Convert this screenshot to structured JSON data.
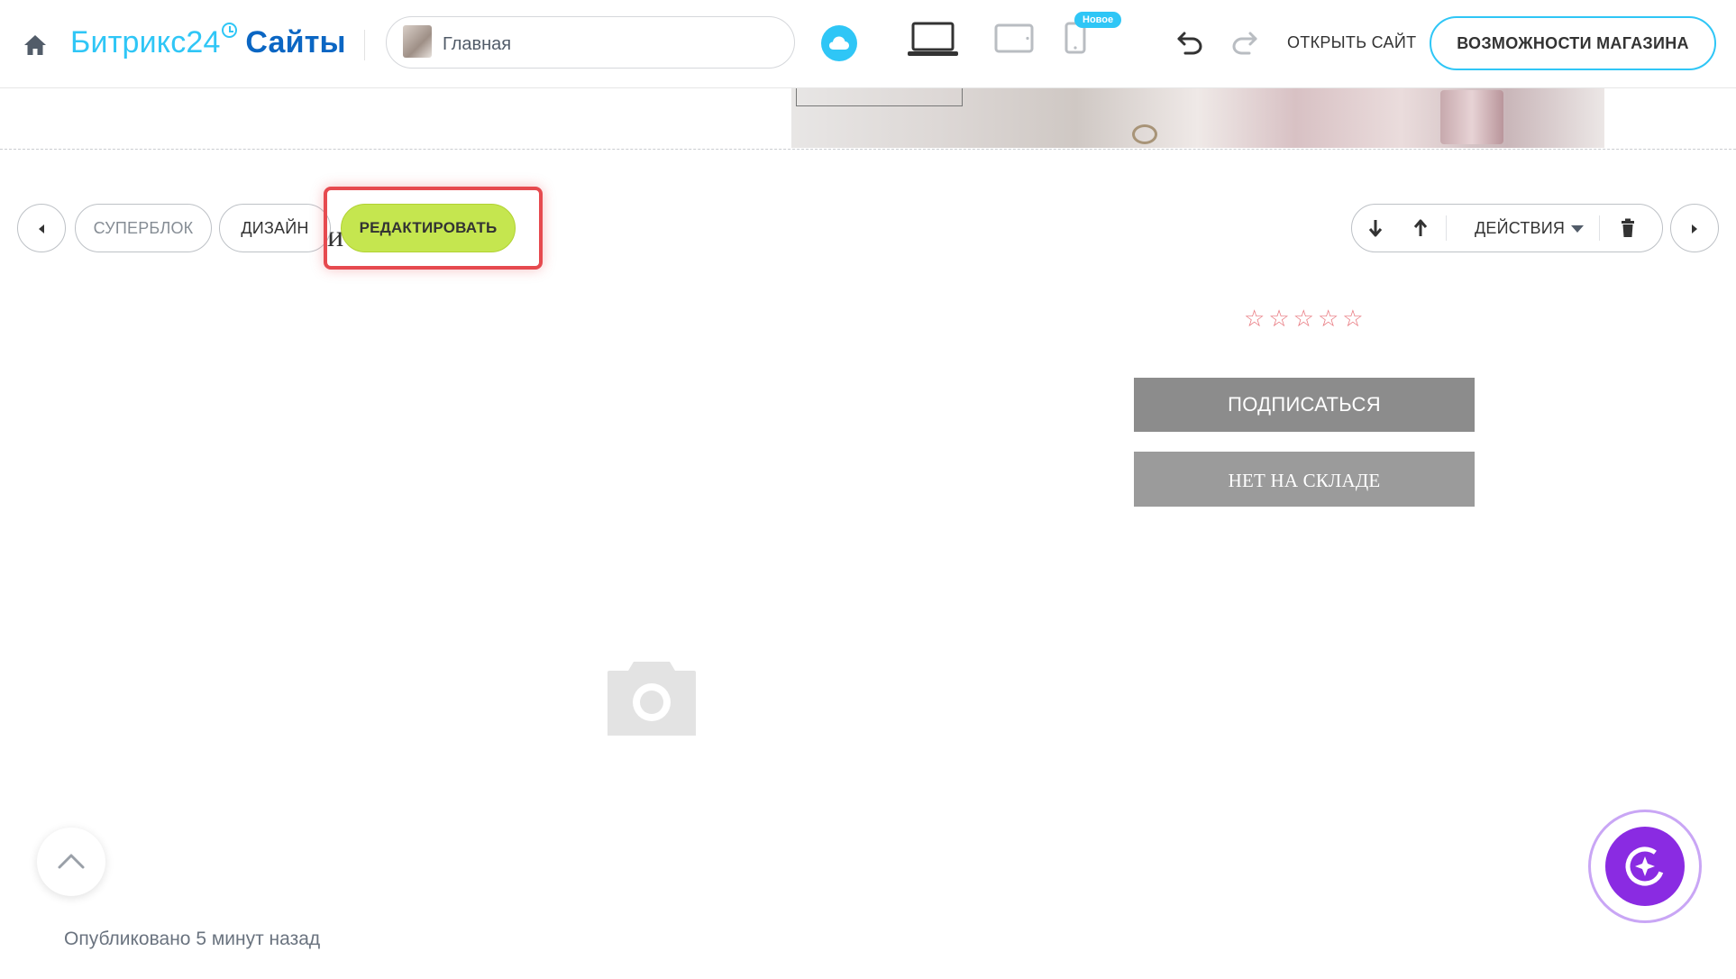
{
  "header": {
    "logo_part1": "Битрикс24",
    "logo_part2": "Сайты",
    "page_select": "Главная",
    "new_badge": "Новое",
    "open_site": "ОТКРЫТЬ САЙТ",
    "store_features": "ВОЗМОЖНОСТИ МАГАЗИНА",
    "icons": [
      "home-icon",
      "cloud-icon",
      "desktop-icon",
      "tablet-icon",
      "mobile-icon",
      "undo-icon",
      "redo-icon"
    ]
  },
  "block_toolbar": {
    "superblock": "СУПЕРБЛОК",
    "design": "ДИЗАЙН",
    "edit": "РЕДАКТИРОВАТЬ",
    "actions": "ДЕЙСТВИЯ",
    "ghost_text": "и",
    "icons": [
      "arrow-left-icon",
      "arrow-down-icon",
      "arrow-up-icon",
      "trash-icon",
      "arrow-right-icon"
    ]
  },
  "product": {
    "rating": 0,
    "rating_max": 5,
    "subscribe": "ПОДПИСАТЬСЯ",
    "out_of_stock": "НЕТ НА СКЛАДЕ"
  },
  "footer": {
    "published": "Опубликовано 5 минут назад"
  },
  "colors": {
    "accent": "#2fc6f6",
    "brand": "#0b66c3",
    "edit_button": "#c5e64f",
    "highlight": "#e64a4f",
    "star": "#e8757c",
    "ai_button": "#8a2be2"
  }
}
